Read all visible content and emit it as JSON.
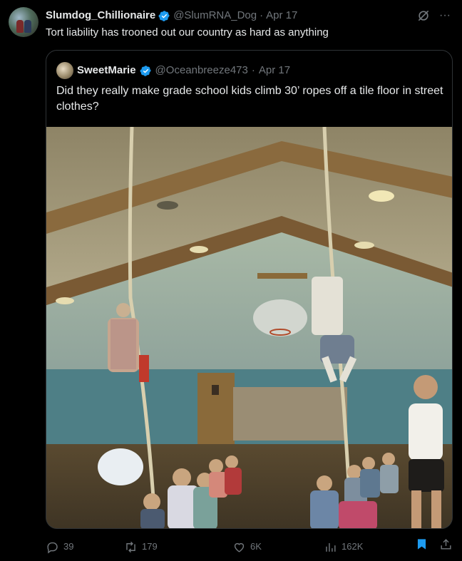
{
  "tweet": {
    "display_name": "Slumdog_Chillionaire",
    "handle": "@SlumRNA_Dog",
    "separator": "·",
    "date": "Apr 17",
    "text": "Tort liability has trooned out our country as hard as anything",
    "more_label": "···"
  },
  "quoted": {
    "display_name": "SweetMarie",
    "handle": "@Oceanbreeze473",
    "separator": "·",
    "date": "Apr 17",
    "text": "Did they really make grade school kids climb 30’ ropes off a tile floor in street clothes?"
  },
  "actions": {
    "replies": "39",
    "reposts": "179",
    "likes": "6K",
    "views": "162K"
  },
  "colors": {
    "background": "#000000",
    "text_primary": "#e7e9ea",
    "text_secondary": "#71767b",
    "verified_blue": "#1d9bf0",
    "bookmark_active": "#1d9bf0",
    "border": "#2f3336"
  },
  "icons": [
    "verified-badge-icon",
    "grok-icon",
    "more-icon",
    "reply-icon",
    "repost-icon",
    "like-icon",
    "views-icon",
    "bookmark-icon",
    "share-icon"
  ]
}
